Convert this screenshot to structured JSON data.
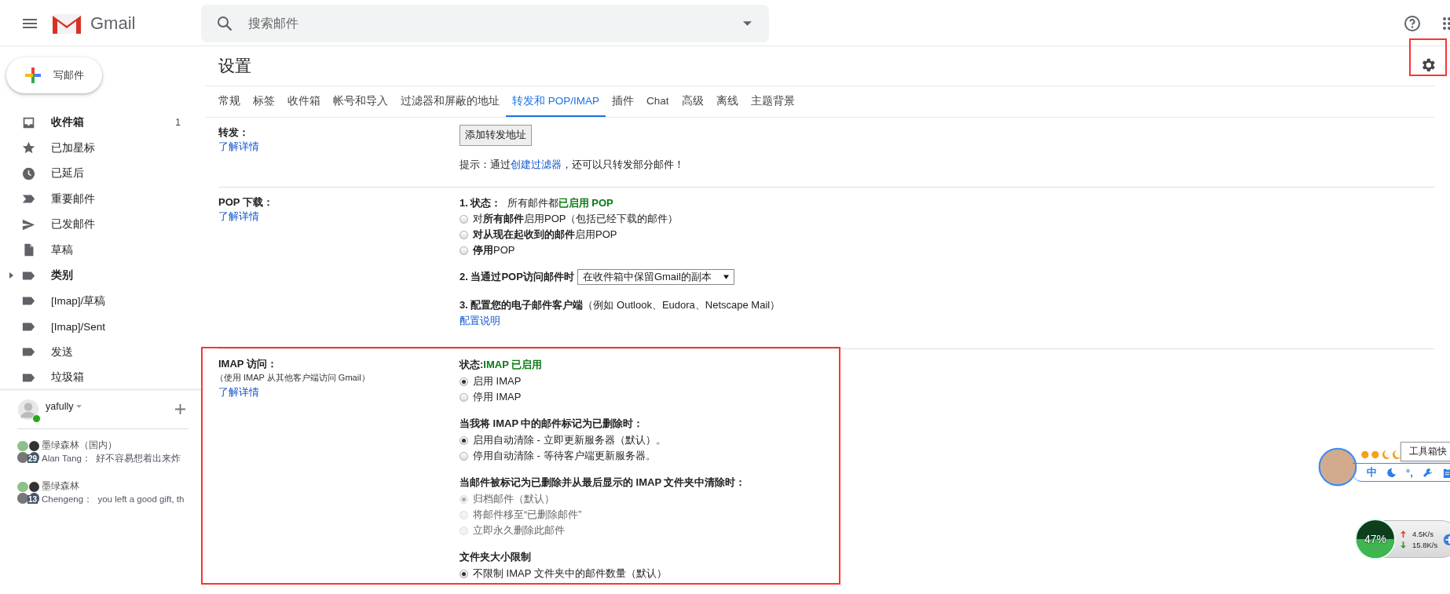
{
  "header": {
    "app_name": "Gmail",
    "search": {
      "placeholder": "搜索邮件"
    }
  },
  "compose": {
    "label": "写邮件"
  },
  "sidebar": {
    "items": [
      {
        "label": "收件箱",
        "kind": "inbox",
        "count": "1",
        "bold": true
      },
      {
        "label": "已加星标",
        "kind": "star",
        "bold": false
      },
      {
        "label": "已延后",
        "kind": "clock",
        "bold": false
      },
      {
        "label": "重要邮件",
        "kind": "important",
        "bold": false
      },
      {
        "label": "已发邮件",
        "kind": "send",
        "bold": false
      },
      {
        "label": "草稿",
        "kind": "draft",
        "bold": false
      },
      {
        "label": "类别",
        "kind": "label",
        "bold": true,
        "expanded": false
      },
      {
        "label": "[Imap]/草稿",
        "kind": "label",
        "bold": false
      },
      {
        "label": "[Imap]/Sent",
        "kind": "label",
        "bold": false
      },
      {
        "label": "发送",
        "kind": "label",
        "bold": false
      },
      {
        "label": "垃圾箱",
        "kind": "label",
        "bold": false
      }
    ]
  },
  "chat": {
    "user": "yafully",
    "online": true,
    "conversations": [
      {
        "title": "墨绿森林（国内）",
        "sender": "Alan Tang：",
        "preview": "好不容易想着出来炸",
        "badge": "29"
      },
      {
        "title": "墨绿森林",
        "sender": "Chengeng：",
        "preview": "you left a good gift, th",
        "badge": "13"
      }
    ]
  },
  "settings": {
    "title": "设置",
    "highlight_gear": true,
    "tabs": [
      {
        "label": "常规",
        "selected": false
      },
      {
        "label": "标签",
        "selected": false
      },
      {
        "label": "收件箱",
        "selected": false
      },
      {
        "label": "帐号和导入",
        "selected": false
      },
      {
        "label": "过滤器和屏蔽的地址",
        "selected": false
      },
      {
        "label": "转发和 POP/IMAP",
        "selected": true
      },
      {
        "label": "插件",
        "selected": false
      },
      {
        "label": "Chat",
        "selected": false
      },
      {
        "label": "高级",
        "selected": false
      },
      {
        "label": "离线",
        "selected": false
      },
      {
        "label": "主题背景",
        "selected": false
      }
    ],
    "forwarding": {
      "label": "转发：",
      "link": "了解详情",
      "button": "添加转发地址",
      "hint_before": "提示：通过",
      "hint_link": "创建过滤器",
      "hint_after": "，还可以只转发部分邮件！"
    },
    "pop": {
      "label": "POP 下载：",
      "link": "了解详情",
      "status_label": "1. 状态：",
      "status_text": "所有邮件都",
      "status_value": "已启用 POP",
      "options": [
        {
          "label": "对**所有邮件**启用POP（包括已经下载的邮件）",
          "selected": false
        },
        {
          "label": "**对从现在起收到的邮件**启用POP",
          "selected": false
        },
        {
          "label": "**停用**POP",
          "selected": false
        }
      ],
      "step2_label": "2. 当通过POP访问邮件时",
      "step2_value": "在收件箱中保留Gmail的副本",
      "step3_label": "3. 配置您的电子邮件客户端",
      "step3_note": "（例如 Outlook、Eudora、Netscape Mail）",
      "step3_link": "配置说明"
    },
    "imap": {
      "label": "IMAP 访问：",
      "note": "（使用 IMAP 从其他客户端访问 Gmail）",
      "link": "了解详情",
      "highlight": true,
      "groups": [
        {
          "heading": "状态: ",
          "status": "IMAP 已启用",
          "options": [
            {
              "label": "启用 IMAP",
              "selected": true,
              "disabled": false
            },
            {
              "label": "停用 IMAP",
              "selected": false,
              "disabled": false
            }
          ]
        },
        {
          "heading": "当我将 IMAP 中的邮件标记为已删除时：",
          "options": [
            {
              "label": "启用自动清除 - 立即更新服务器（默认）。",
              "selected": true,
              "disabled": false
            },
            {
              "label": "停用自动清除 - 等待客户端更新服务器。",
              "selected": false,
              "disabled": false
            }
          ]
        },
        {
          "heading": "当邮件被标记为已删除并从最后显示的 IMAP 文件夹中清除时：",
          "options": [
            {
              "label": "归档邮件（默认）",
              "selected": true,
              "disabled": true
            },
            {
              "label": "将邮件移至“已删除邮件”",
              "selected": false,
              "disabled": true
            },
            {
              "label": "立即永久删除此邮件",
              "selected": false,
              "disabled": true
            }
          ]
        },
        {
          "heading": "文件夹大小限制",
          "options": [
            {
              "label": "不限制 IMAP 文件夹中的邮件数量（默认）",
              "selected": true,
              "disabled": false
            }
          ]
        }
      ]
    }
  },
  "widgets": {
    "tooltip": "工具箱快",
    "toolbar": [
      {
        "kind": "text",
        "label": "中"
      },
      {
        "kind": "moon"
      },
      {
        "kind": "text",
        "label": "°,"
      },
      {
        "kind": "wrench"
      },
      {
        "kind": "clipboard"
      }
    ],
    "meter": {
      "reading": "47%",
      "upload": "4.5K/s",
      "download": "15.8K/s"
    }
  }
}
